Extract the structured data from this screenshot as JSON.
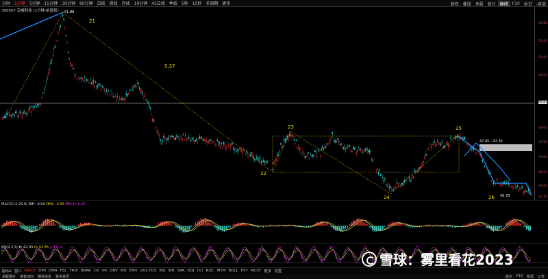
{
  "topbar": {
    "tabs": [
      "分时",
      "1分钟",
      "5分钟",
      "15分钟",
      "30分钟",
      "60分钟",
      "日线",
      "周线",
      "月线",
      "10分钟",
      "45日线",
      "季线",
      "5秒",
      "15秒",
      "多周期",
      "更多"
    ],
    "active_tab": "1分钟",
    "tools": [
      "复权",
      "叠加",
      "多股",
      "统计",
      "画线",
      "F10",
      "标记",
      "-自选"
    ],
    "active_tool": "画线"
  },
  "stock": {
    "label": "300007 汉威科技 (1分钟-前复权)"
  },
  "price_axis": {
    "labels": [
      "51.88",
      "50.83",
      "50.00",
      "49.53",
      "48.81",
      "48.00",
      "47.56",
      "47.00",
      "46.53",
      "46.00",
      "45.70"
    ]
  },
  "annotations": {
    "peak_price": "51.88",
    "wave_21": "21",
    "wave_22": "22",
    "wave_23": "23",
    "wave_24": "24",
    "wave_25": "25",
    "wave_26": "26",
    "ratio": "5.37",
    "range_label": "47.45 - 47.20",
    "low_label": "45.70",
    "current_price": "48.81"
  },
  "macd": {
    "label": "MACD(12,26,9)",
    "dif": "DIF: -0.04",
    "dea": "DEA: -0.05",
    "macd": "MACD: 0.02"
  },
  "kd": {
    "label": "KD(9,3,3)",
    "k": "K: 42.93",
    "d": "D: 52.85",
    "j": "J: 23.11"
  },
  "indicators": [
    "指标A",
    "窗口",
    "MACD",
    "DMI",
    "DMA",
    "FSL",
    "TRIX",
    "BRAR",
    "CR",
    "VR",
    "OBV",
    "ASI",
    "EMV",
    "VOL-TDX",
    "RSI",
    "WR",
    "SAR",
    "KDJ",
    "CCI",
    "ROC",
    "MTM",
    "BOLL",
    "PSY",
    "MCST",
    "更多",
    "设置"
  ],
  "active_indicator": "MACD",
  "bottombar": {
    "items": [
      "关联报价",
      "资金流向",
      "相关信息",
      "板块资讯"
    ],
    "right_items": [
      "提示",
      "F10",
      "新闻",
      "公告"
    ]
  },
  "watermark": {
    "text": "雪球：雾里看花2023"
  },
  "colors": {
    "up": "#ff3b3b",
    "down": "#27d3d3",
    "annotation": "#f0e000",
    "trendline": "#1e90ff"
  }
}
